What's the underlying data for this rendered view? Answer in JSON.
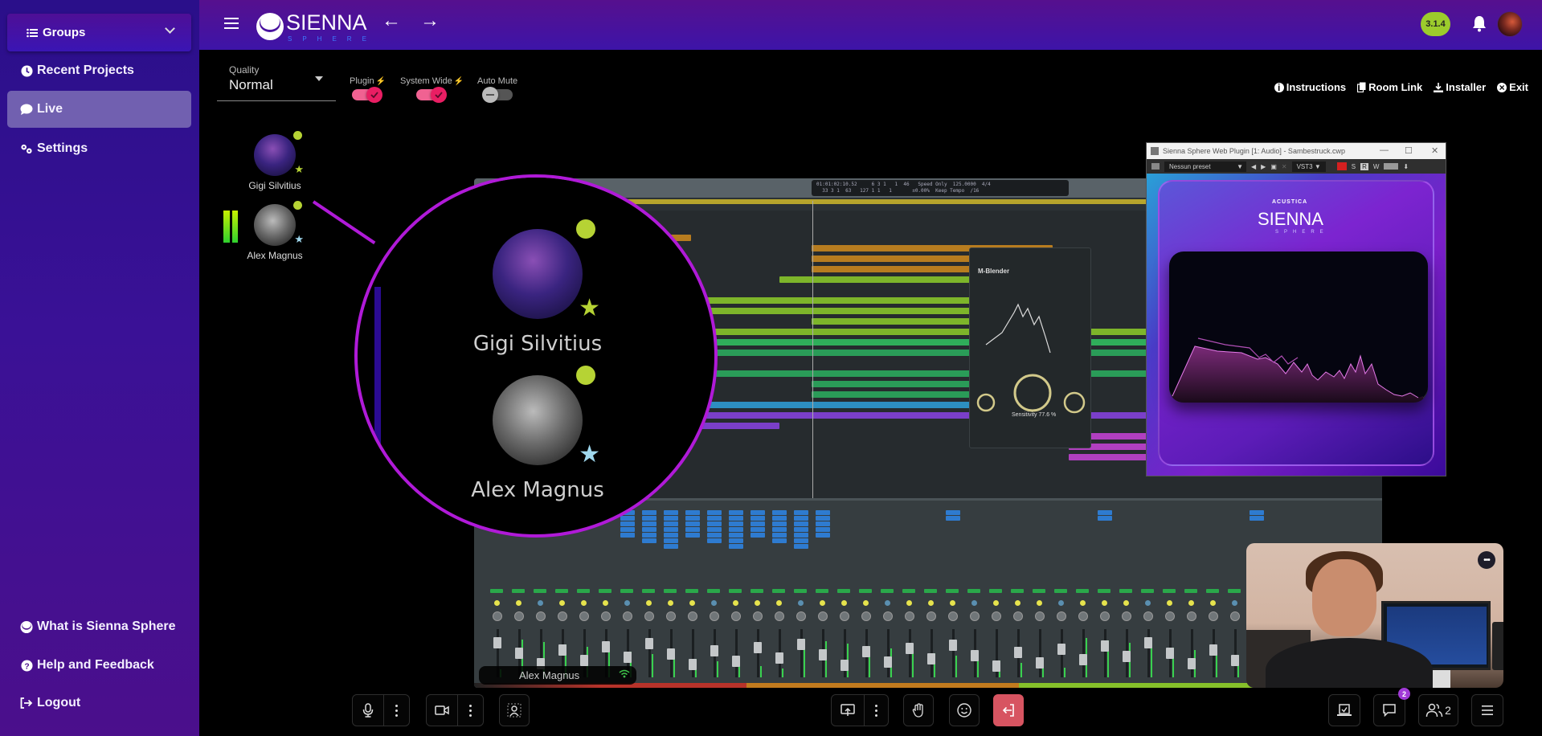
{
  "sidebar": {
    "groups_label": "Groups",
    "items": [
      {
        "label": "Recent Projects",
        "icon": "clock-icon"
      },
      {
        "label": "Live",
        "icon": "chat-icon",
        "active": true
      },
      {
        "label": "Settings",
        "icon": "gears-icon"
      }
    ],
    "footer_items": [
      {
        "label": "What is Sienna Sphere",
        "icon": "sienna-logo-icon"
      },
      {
        "label": "Help and Feedback",
        "icon": "question-circle-icon"
      },
      {
        "label": "Logout",
        "icon": "logout-icon"
      }
    ]
  },
  "header": {
    "logo_text": "SIENNA",
    "logo_sub": "SPHERE",
    "back_arrow": "←",
    "forward_arrow": "→",
    "version": "3.1.4",
    "colors": {
      "version_badge": "#9ccc2c",
      "accent": "#b01ad8",
      "toggle_on": "#e91e63"
    }
  },
  "controls": {
    "quality_label": "Quality",
    "quality_value": "Normal",
    "toggles": [
      {
        "label": "Plugin",
        "on": true,
        "plug_icon": true
      },
      {
        "label": "System Wide",
        "on": true,
        "plug_icon": true
      },
      {
        "label": "Auto Mute",
        "on": false,
        "plug_icon": false
      }
    ],
    "links": [
      {
        "label": "Instructions",
        "icon": "info-icon"
      },
      {
        "label": "Room Link",
        "icon": "copy-icon"
      },
      {
        "label": "Installer",
        "icon": "download-icon"
      },
      {
        "label": "Exit",
        "icon": "close-circle-icon"
      }
    ]
  },
  "participants": [
    {
      "name": "Gigi Silvitius",
      "status": "online",
      "star_color": "#b6d334"
    },
    {
      "name": "Alex Magnus",
      "status": "online",
      "star_color": "#9fd8ee",
      "speaking": true
    }
  ],
  "screen_share": {
    "presenter": "Alex Magnus",
    "daw_lcd_line1": "01:01:02:10.52     6 3 1   1  46   Speed Only  125.0000  4/4",
    "daw_lcd_line2": "  33 3 1  63   127 1 1   1       ±0.00%  Keep Tempo  /16",
    "mblender_title": "M-Blender",
    "mblender_param": "Sensitivity",
    "mblender_value": "77.6 %"
  },
  "plugin_window": {
    "title": "Sienna Sphere Web Plugin [1: Audio] - Sambestruck.cwp",
    "preset": "Nessun preset",
    "format": "VST3",
    "buttons": [
      "S",
      "R",
      "W"
    ],
    "brand": "ACUSTICA",
    "logo_text": "SIENNA",
    "logo_sub": "SPHERE"
  },
  "camera_tile": {
    "more_label": "•••"
  },
  "bottom_bar": {
    "chat_badge": "2",
    "participants_count": "2"
  }
}
